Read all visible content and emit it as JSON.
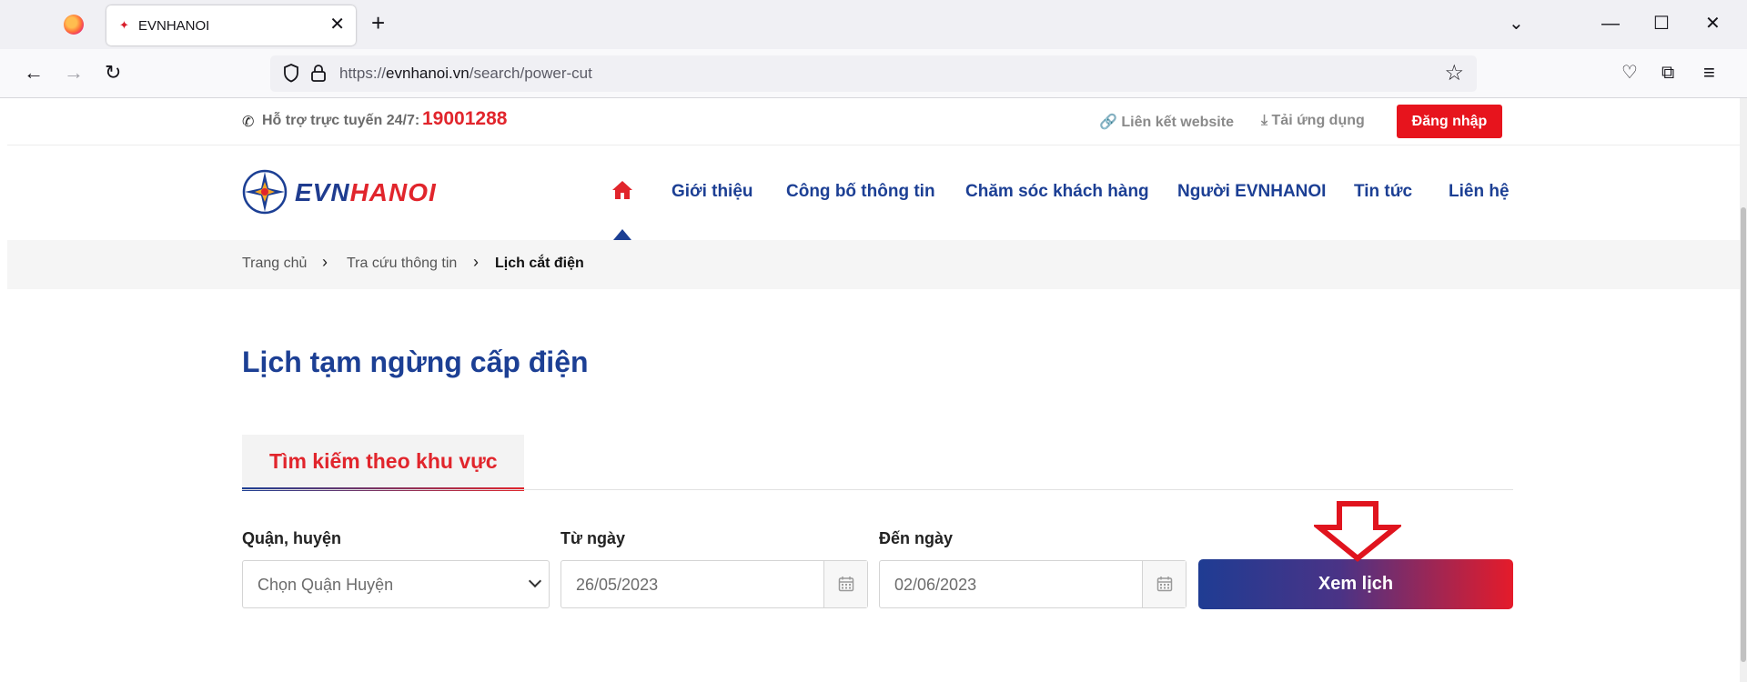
{
  "browser": {
    "tab_title": "EVNHANOI",
    "tab_close": "✕",
    "new_tab": "+",
    "url_prefix": "https://",
    "url_domain": "evnhanoi.vn",
    "url_path": "/search/power-cut",
    "window_controls": [
      "⌄",
      "—",
      "☐",
      "✕"
    ]
  },
  "topbar": {
    "support_label": "Hỗ trợ trực tuyến 24/7:",
    "support_phone": "19001288",
    "link_website": "Liên kết website",
    "link_app": "Tải ứng dụng",
    "login_label": "Đăng nhập"
  },
  "logo": {
    "part1": "EVN",
    "part2": "HANOI"
  },
  "menu": {
    "items": [
      "Giới thiệu",
      "Công bố thông tin",
      "Chăm sóc khách hàng",
      "Người EVNHANOI",
      "Tin tức",
      "Liên hệ"
    ]
  },
  "breadcrumb": {
    "items": [
      "Trang chủ",
      "Tra cứu thông tin",
      "Lịch cắt điện"
    ],
    "separator": "›"
  },
  "main": {
    "title": "Lịch tạm ngừng cấp điện",
    "tab_label": "Tìm kiếm theo khu vực"
  },
  "form": {
    "district_label": "Quận, huyện",
    "district_placeholder": "Chọn Quận Huyện",
    "from_label": "Từ ngày",
    "from_value": "26/05/2023",
    "to_label": "Đến ngày",
    "to_value": "02/06/2023",
    "submit_label": "Xem lịch"
  },
  "colors": {
    "brand_blue": "#1c3f94",
    "brand_red": "#e1252c",
    "annotation_arrow": "#e0141e"
  }
}
